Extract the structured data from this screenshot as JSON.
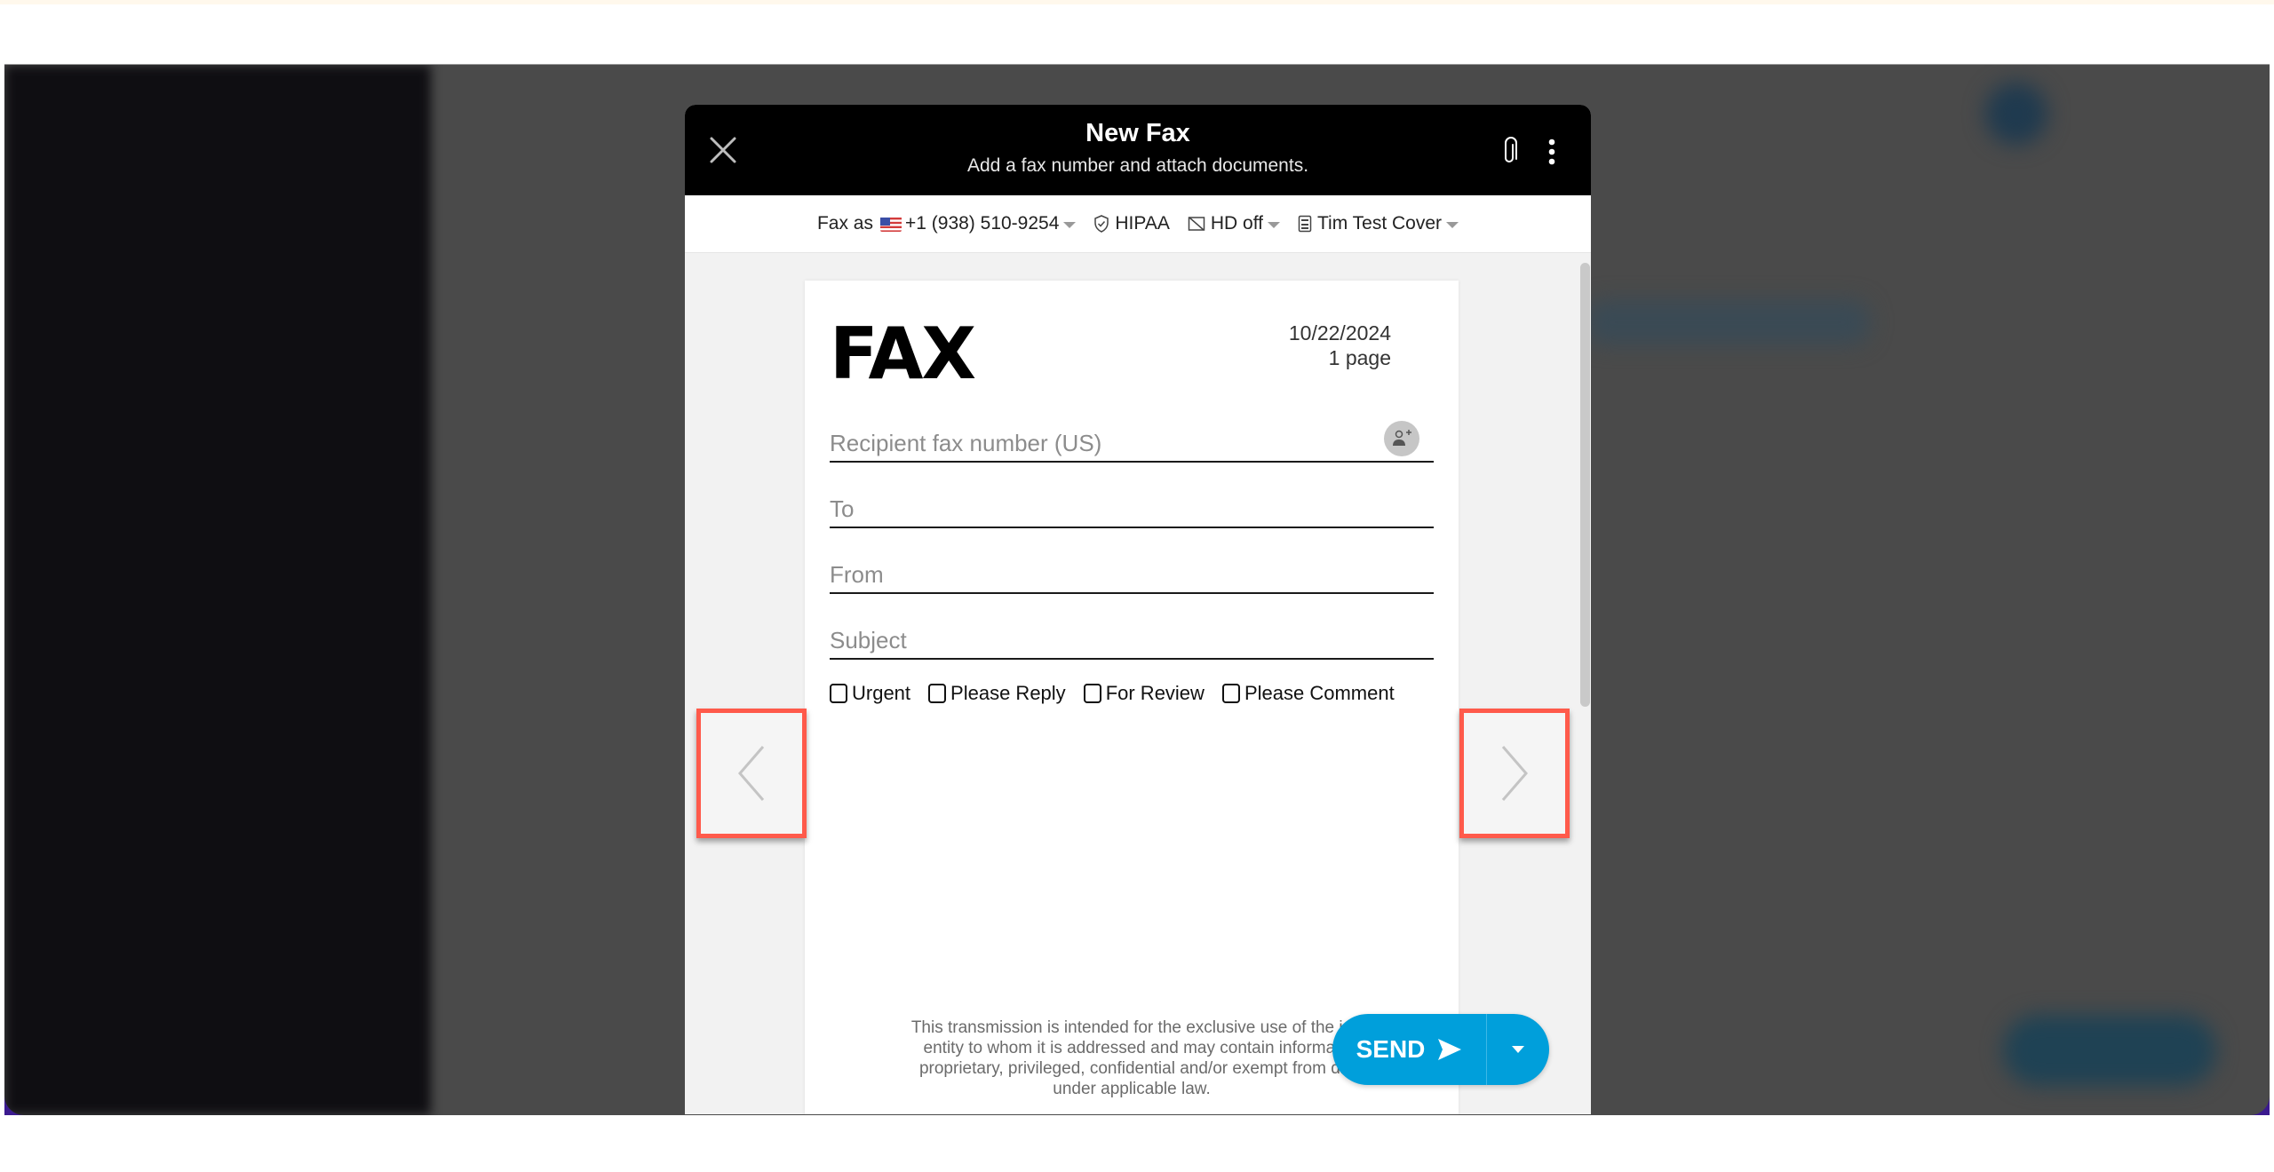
{
  "modal": {
    "title": "New Fax",
    "subtitle": "Add a fax number and attach documents.",
    "icons": {
      "close": "close-icon",
      "attach": "paperclip-icon",
      "more": "more-vertical-icon"
    }
  },
  "options": {
    "fax_as_label": "Fax as",
    "fax_number": "+1 (938) 510-9254",
    "hipaa_label": "HIPAA",
    "hd_label": "HD off",
    "cover_label": "Tim Test Cover"
  },
  "cover_page": {
    "heading": "FAX",
    "date": "10/22/2024",
    "page_count": "1 page",
    "recipient_placeholder": "Recipient fax number (US)",
    "to_placeholder": "To",
    "from_placeholder": "From",
    "subject_placeholder": "Subject",
    "checkboxes": [
      {
        "label": "Urgent",
        "checked": false
      },
      {
        "label": "Please Reply",
        "checked": false
      },
      {
        "label": "For Review",
        "checked": false
      },
      {
        "label": "Please Comment",
        "checked": false
      }
    ],
    "disclaimer_lines": [
      "This transmission is intended for the exclusive use of the in",
      "entity to whom it is addressed and may contain informat",
      "proprietary, privileged, confidential and/or exempt from di",
      "under applicable law."
    ]
  },
  "send": {
    "label": "SEND"
  },
  "colors": {
    "accent": "#009fdb",
    "highlight": "#ff5a4b",
    "header_bg": "#000000"
  }
}
